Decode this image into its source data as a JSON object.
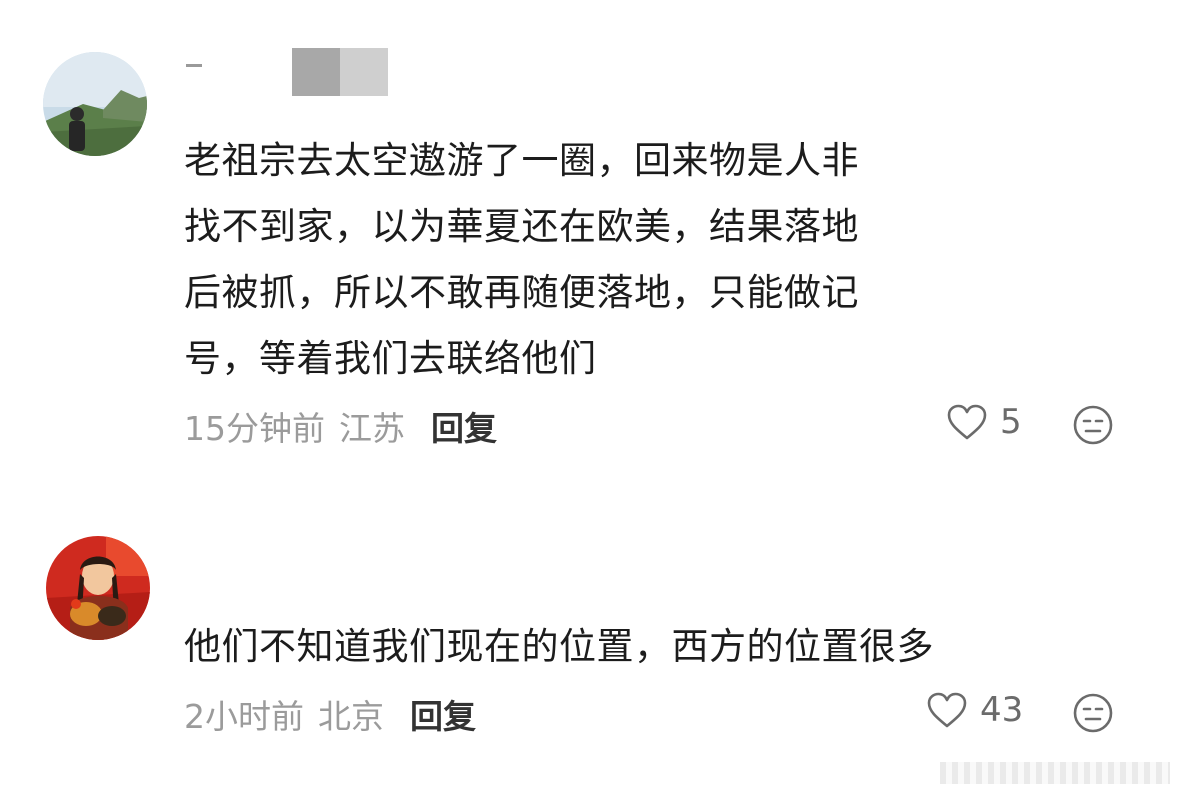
{
  "comments": [
    {
      "avatar": "avatar-person-landscape",
      "lines": [
        "老祖宗去太空遨游了一圈，回来物是人非",
        "找不到家，以为華夏还在欧美，结果落地",
        "后被抓，所以不敢再随便落地，只能做记",
        "号，等着我们去联络他们"
      ],
      "time": "15分钟前",
      "location": "江苏",
      "reply_label": "回复",
      "likes": "5"
    },
    {
      "avatar": "avatar-woman-rooster",
      "lines": [
        "他们不知道我们现在的位置，西方的位置很多"
      ],
      "time": "2小时前",
      "location": "北京",
      "reply_label": "回复",
      "likes": "43"
    }
  ],
  "icons": {
    "like": "heart-outline-icon",
    "reaction": "neutral-face-icon"
  },
  "colors": {
    "text": "#1c1c1c",
    "meta": "#9b9b9b",
    "reply": "#333333"
  }
}
